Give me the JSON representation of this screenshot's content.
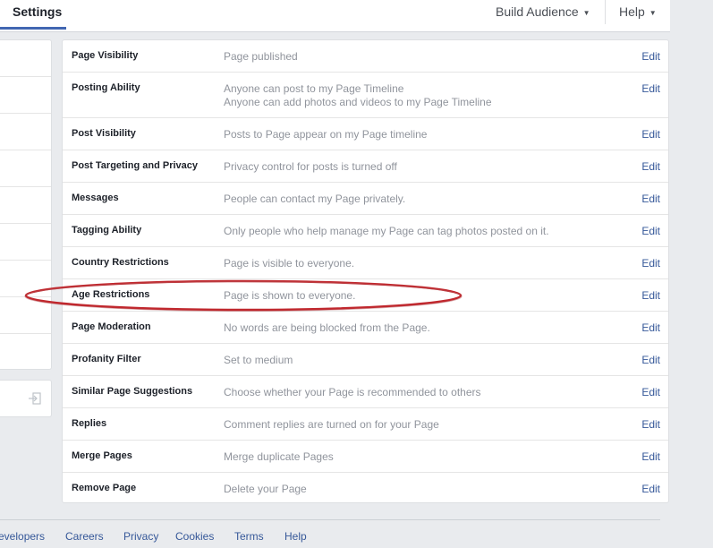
{
  "header": {
    "settings_tab": "Settings",
    "build_audience": "Build Audience",
    "help": "Help"
  },
  "settings": [
    {
      "label": "Page Visibility",
      "value": [
        "Page published"
      ],
      "edit": "Edit"
    },
    {
      "label": "Posting Ability",
      "value": [
        "Anyone can post to my Page Timeline",
        "Anyone can add photos and videos to my Page Timeline"
      ],
      "edit": "Edit"
    },
    {
      "label": "Post Visibility",
      "value": [
        "Posts to Page appear on my Page timeline"
      ],
      "edit": "Edit"
    },
    {
      "label": "Post Targeting and Privacy",
      "value": [
        "Privacy control for posts is turned off"
      ],
      "edit": "Edit"
    },
    {
      "label": "Messages",
      "value": [
        "People can contact my Page privately."
      ],
      "edit": "Edit"
    },
    {
      "label": "Tagging Ability",
      "value": [
        "Only people who help manage my Page can tag photos posted on it."
      ],
      "edit": "Edit"
    },
    {
      "label": "Country Restrictions",
      "value": [
        "Page is visible to everyone."
      ],
      "edit": "Edit"
    },
    {
      "label": "Age Restrictions",
      "value": [
        "Page is shown to everyone."
      ],
      "edit": "Edit"
    },
    {
      "label": "Page Moderation",
      "value": [
        "No words are being blocked from the Page."
      ],
      "edit": "Edit"
    },
    {
      "label": "Profanity Filter",
      "value": [
        "Set to medium"
      ],
      "edit": "Edit"
    },
    {
      "label": "Similar Page Suggestions",
      "value": [
        "Choose whether your Page is recommended to others"
      ],
      "edit": "Edit"
    },
    {
      "label": "Replies",
      "value": [
        "Comment replies are turned on for your Page"
      ],
      "edit": "Edit"
    },
    {
      "label": "Merge Pages",
      "value": [
        "Merge duplicate Pages"
      ],
      "edit": "Edit"
    },
    {
      "label": "Remove Page",
      "value": [
        "Delete your Page"
      ],
      "edit": "Edit"
    }
  ],
  "footer": {
    "links": [
      "evelopers",
      "Careers",
      "Privacy",
      "Cookies",
      "Terms",
      "Help"
    ]
  },
  "colors": {
    "link": "#365899",
    "muted_text": "#90949c",
    "highlight_ellipse": "#c0272d",
    "tab_underline": "#4267b2"
  },
  "icons": {
    "dropdown": "caret-down-icon",
    "sidebar_bottom": "log-out-icon"
  }
}
